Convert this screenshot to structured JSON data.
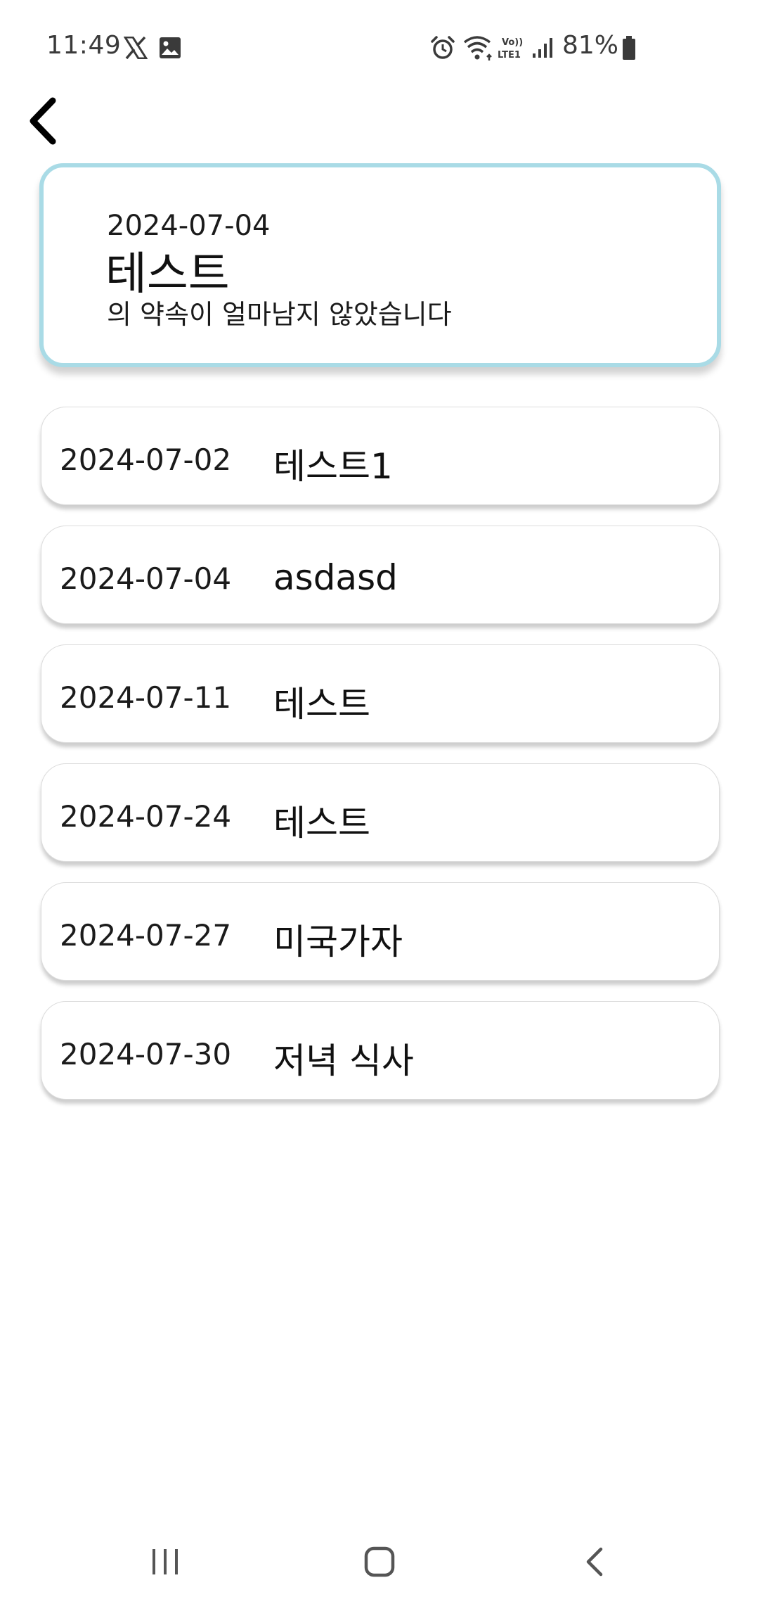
{
  "status_bar": {
    "time": "11:49",
    "battery": "81%",
    "left_icons": [
      "x-app-icon",
      "gallery-icon"
    ],
    "right_icons": [
      "alarm-icon",
      "wifi-icon",
      "volte-icon",
      "signal-icon",
      "battery-icon"
    ]
  },
  "header": {
    "back_icon": "chevron-left-icon"
  },
  "highlight": {
    "date": "2024-07-04",
    "title": "테스트",
    "message": "의 약속이 얼마남지 않았습니다",
    "border_color": "#a9dbe6"
  },
  "appointments": [
    {
      "date": "2024-07-02",
      "title": "테스트1"
    },
    {
      "date": "2024-07-04",
      "title": "asdasd"
    },
    {
      "date": "2024-07-11",
      "title": "테스트"
    },
    {
      "date": "2024-07-24",
      "title": "테스트"
    },
    {
      "date": "2024-07-27",
      "title": "미국가자"
    },
    {
      "date": "2024-07-30",
      "title": "저녁 식사"
    }
  ],
  "nav_bar": {
    "icons": [
      "recent-apps-icon",
      "home-icon",
      "back-icon"
    ]
  }
}
